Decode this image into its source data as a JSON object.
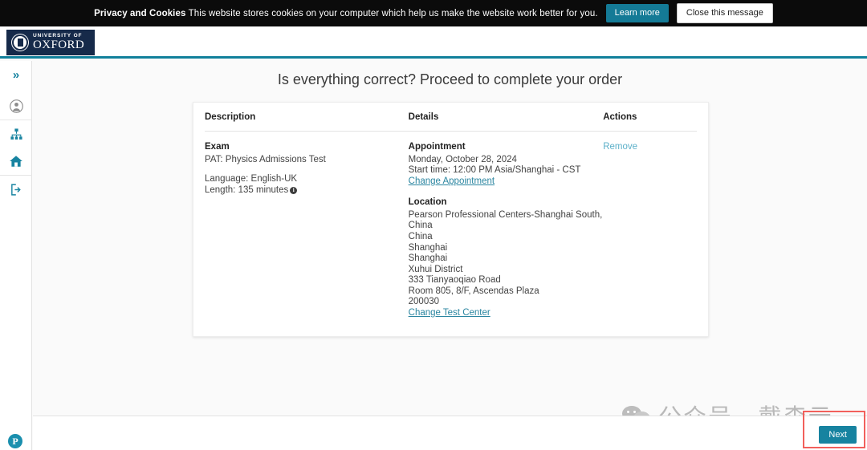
{
  "cookie_banner": {
    "title": "Privacy and Cookies",
    "message": " This website stores cookies on your computer which help us make the website work better for you.",
    "learn_more_label": "Learn more",
    "close_label": "Close this message"
  },
  "header": {
    "logo_university": "UNIVERSITY OF",
    "logo_name": "OXFORD"
  },
  "sidebar": {
    "items": [
      {
        "name": "expand-chevrons-icon",
        "glyph": "»"
      },
      {
        "name": "account-icon",
        "glyph": ""
      },
      {
        "name": "sitemap-icon",
        "glyph": ""
      },
      {
        "name": "home-icon",
        "glyph": ""
      },
      {
        "name": "sign-out-icon",
        "glyph": ""
      }
    ]
  },
  "main": {
    "page_title": "Is everything correct? Proceed to complete your order",
    "table": {
      "headers": {
        "description": "Description",
        "details": "Details",
        "actions": "Actions"
      },
      "row": {
        "exam": {
          "title": "Exam",
          "name": "PAT: Physics Admissions Test",
          "language": "Language: English-UK",
          "length": "Length: 135 minutes",
          "info_glyph": "i"
        },
        "appointment": {
          "title": "Appointment",
          "date": "Monday, October 28, 2024",
          "start_time": "Start time: 12:00 PM Asia/Shanghai - CST",
          "change_link": "Change Appointment"
        },
        "location": {
          "title": "Location",
          "lines": [
            "Pearson Professional Centers-Shanghai South, China",
            "China",
            "Shanghai",
            "Shanghai",
            "Xuhui District",
            "333 Tianyaoqiao Road",
            "Room 805, 8/F, Ascendas Plaza",
            "200030"
          ],
          "change_link": "Change Test Center"
        },
        "actions": {
          "remove_label": "Remove"
        }
      }
    }
  },
  "footer": {
    "next_label": "Next"
  },
  "branding": {
    "pearson_letter": "P"
  },
  "watermark": {
    "text": "公众号 · 戴森云"
  },
  "colors": {
    "teal": "#1783a0",
    "oxford_navy": "#162a4a",
    "link": "#2a85a0",
    "highlight_red": "#f2605c",
    "banner_black": "#0b0b0b"
  }
}
